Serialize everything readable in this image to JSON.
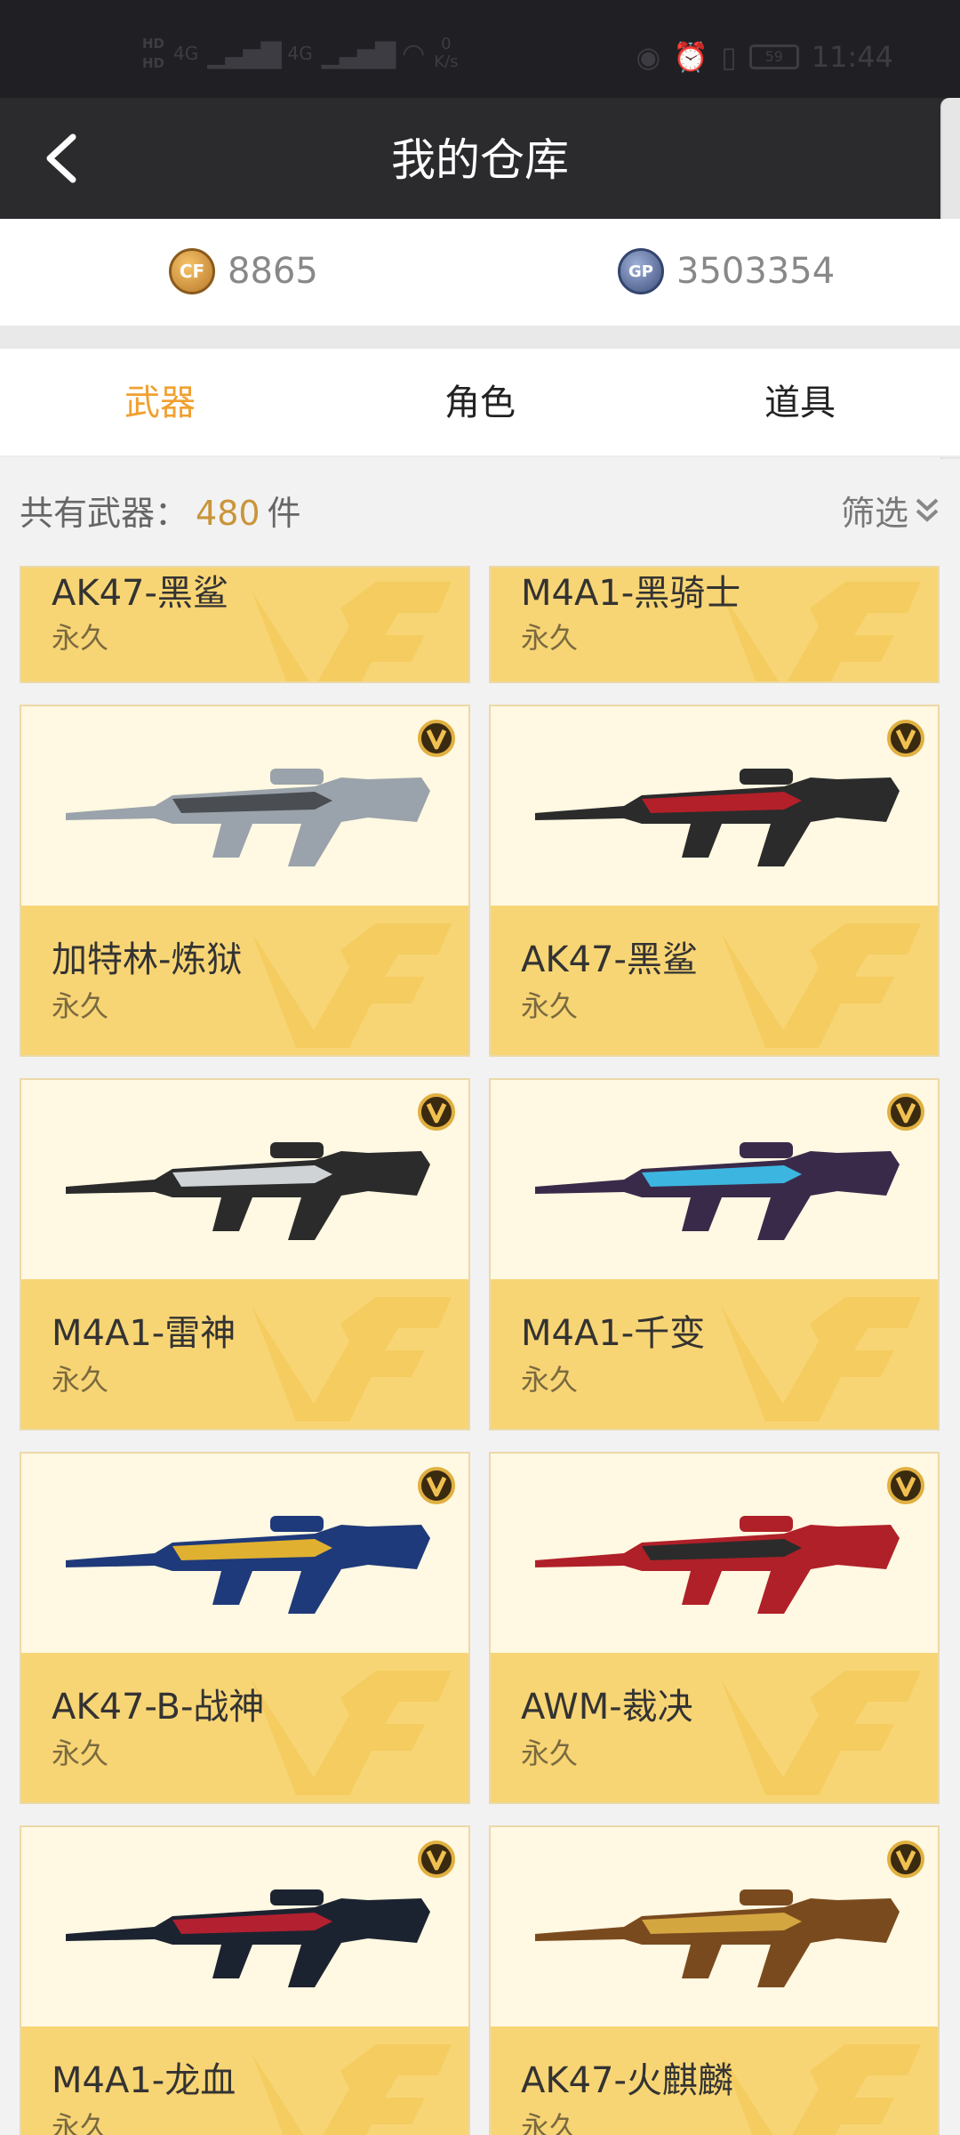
{
  "status_bar": {
    "hd_top": "HD",
    "hd_bottom": "HD",
    "net_1": "4G",
    "net_2": "4G",
    "speed_value": "0",
    "speed_unit": "K/s",
    "battery": "59",
    "time": "11:44"
  },
  "header": {
    "title": "我的仓库"
  },
  "currency": {
    "coin_value": "8865",
    "coin_icon_label": "CF",
    "gp_value": "3503354",
    "gp_icon_label": "GP"
  },
  "tabs": [
    {
      "label": "武器",
      "active": true
    },
    {
      "label": "角色",
      "active": false
    },
    {
      "label": "道具",
      "active": false
    }
  ],
  "count": {
    "label": "共有武器：",
    "value": "480",
    "unit": "件"
  },
  "filter": {
    "label": "筛选"
  },
  "items": [
    {
      "name": "AK47-黑鲨",
      "duration": "永久"
    },
    {
      "name": "M4A1-黑骑士",
      "duration": "永久"
    },
    {
      "name": "加特林-炼狱",
      "duration": "永久"
    },
    {
      "name": "AK47-黑鲨",
      "duration": "永久"
    },
    {
      "name": "M4A1-雷神",
      "duration": "永久"
    },
    {
      "name": "M4A1-千变",
      "duration": "永久"
    },
    {
      "name": "AK47-B-战神",
      "duration": "永久"
    },
    {
      "name": "AWM-裁决",
      "duration": "永久"
    },
    {
      "name": "M4A1-龙血",
      "duration": "永久"
    },
    {
      "name": "AK47-火麒麟",
      "duration": "永久"
    }
  ],
  "colors": {
    "header_bg": "#2b2b2e",
    "accent": "#f0a030",
    "card_info": "#f8d574",
    "card_img_bg": "#fff8e2"
  }
}
